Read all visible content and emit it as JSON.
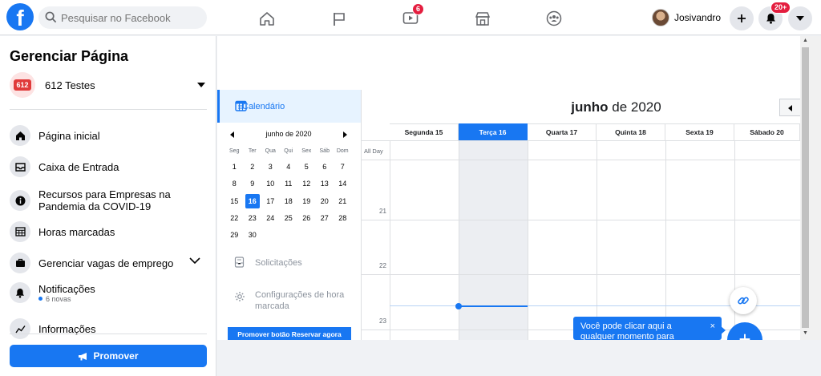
{
  "topbar": {
    "logo": "f",
    "search_placeholder": "Pesquisar no Facebook",
    "video_badge": "6",
    "notifications_badge": "20+",
    "profile_name": "Josivandro"
  },
  "sidebar": {
    "title": "Gerenciar Página",
    "page_avatar_text": "612",
    "page_name": "612 Testes",
    "items": [
      {
        "label": "Página inicial",
        "icon": "home-icon"
      },
      {
        "label": "Caixa de Entrada",
        "icon": "inbox-icon"
      },
      {
        "label": "Recursos para Empresas na Pandemia da COVID-19",
        "icon": "info-icon"
      },
      {
        "label": "Horas marcadas",
        "icon": "table-icon"
      },
      {
        "label": "Gerenciar vagas de emprego",
        "icon": "briefcase-icon"
      },
      {
        "label": "Notificações",
        "sublabel": "6 novas",
        "icon": "bell-icon"
      },
      {
        "label": "Informações",
        "icon": "insights-icon"
      }
    ],
    "promote_label": "Promover"
  },
  "booking_nav": {
    "calendar_label": "Calendário",
    "mini_calendar": {
      "title": "junho de 2020",
      "weekdays": [
        "Seg",
        "Ter",
        "Qua",
        "Qui",
        "Sex",
        "Sáb",
        "Dom"
      ],
      "days": [
        "1",
        "2",
        "3",
        "4",
        "5",
        "6",
        "7",
        "8",
        "9",
        "10",
        "11",
        "12",
        "13",
        "14",
        "15",
        "16",
        "17",
        "18",
        "19",
        "20",
        "21",
        "22",
        "23",
        "24",
        "25",
        "26",
        "27",
        "28",
        "29",
        "30"
      ],
      "selected": "16"
    },
    "requests_label": "Solicitações",
    "settings_label": "Configurações de hora marcada",
    "reserve_button_label": "Promover botão Reservar agora"
  },
  "calendar": {
    "month_bold": "junho",
    "month_rest": " de 2020",
    "columns": [
      "Segunda 15",
      "Terça 16",
      "Quarta 17",
      "Quinta 18",
      "Sexta 19",
      "Sábado 20"
    ],
    "today_index": 1,
    "all_day_label": "All Day",
    "hours": [
      "21",
      "22",
      "23"
    ]
  },
  "tooltip": {
    "text": "Você pode clicar aqui a qualquer momento para",
    "close": "×"
  },
  "fab_label": "+",
  "colors": {
    "brand": "#1877f2",
    "badge": "#e41e3f"
  }
}
